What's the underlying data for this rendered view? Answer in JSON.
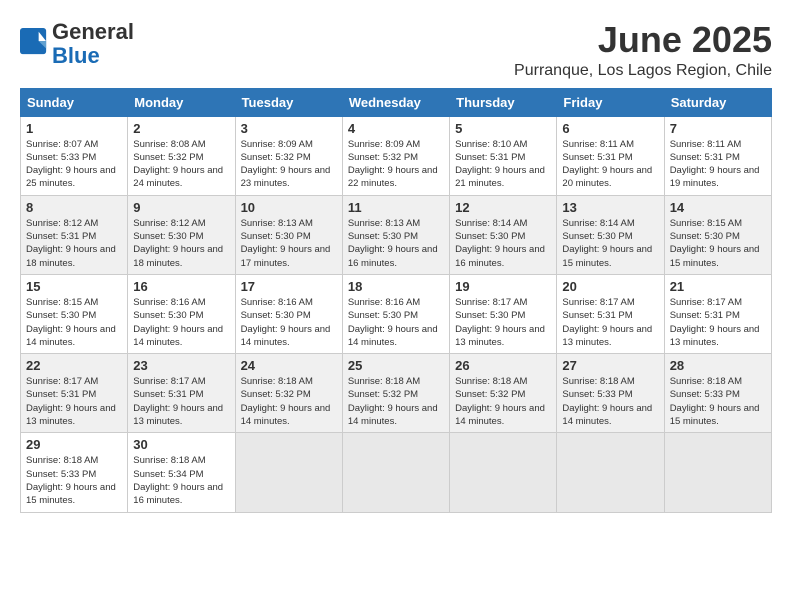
{
  "logo": {
    "general": "General",
    "blue": "Blue"
  },
  "title": "June 2025",
  "location": "Purranque, Los Lagos Region, Chile",
  "weekdays": [
    "Sunday",
    "Monday",
    "Tuesday",
    "Wednesday",
    "Thursday",
    "Friday",
    "Saturday"
  ],
  "weeks": [
    [
      {
        "day": "1",
        "sunrise": "8:07 AM",
        "sunset": "5:33 PM",
        "daylight": "9 hours and 25 minutes."
      },
      {
        "day": "2",
        "sunrise": "8:08 AM",
        "sunset": "5:32 PM",
        "daylight": "9 hours and 24 minutes."
      },
      {
        "day": "3",
        "sunrise": "8:09 AM",
        "sunset": "5:32 PM",
        "daylight": "9 hours and 23 minutes."
      },
      {
        "day": "4",
        "sunrise": "8:09 AM",
        "sunset": "5:32 PM",
        "daylight": "9 hours and 22 minutes."
      },
      {
        "day": "5",
        "sunrise": "8:10 AM",
        "sunset": "5:31 PM",
        "daylight": "9 hours and 21 minutes."
      },
      {
        "day": "6",
        "sunrise": "8:11 AM",
        "sunset": "5:31 PM",
        "daylight": "9 hours and 20 minutes."
      },
      {
        "day": "7",
        "sunrise": "8:11 AM",
        "sunset": "5:31 PM",
        "daylight": "9 hours and 19 minutes."
      }
    ],
    [
      {
        "day": "8",
        "sunrise": "8:12 AM",
        "sunset": "5:31 PM",
        "daylight": "9 hours and 18 minutes."
      },
      {
        "day": "9",
        "sunrise": "8:12 AM",
        "sunset": "5:30 PM",
        "daylight": "9 hours and 18 minutes."
      },
      {
        "day": "10",
        "sunrise": "8:13 AM",
        "sunset": "5:30 PM",
        "daylight": "9 hours and 17 minutes."
      },
      {
        "day": "11",
        "sunrise": "8:13 AM",
        "sunset": "5:30 PM",
        "daylight": "9 hours and 16 minutes."
      },
      {
        "day": "12",
        "sunrise": "8:14 AM",
        "sunset": "5:30 PM",
        "daylight": "9 hours and 16 minutes."
      },
      {
        "day": "13",
        "sunrise": "8:14 AM",
        "sunset": "5:30 PM",
        "daylight": "9 hours and 15 minutes."
      },
      {
        "day": "14",
        "sunrise": "8:15 AM",
        "sunset": "5:30 PM",
        "daylight": "9 hours and 15 minutes."
      }
    ],
    [
      {
        "day": "15",
        "sunrise": "8:15 AM",
        "sunset": "5:30 PM",
        "daylight": "9 hours and 14 minutes."
      },
      {
        "day": "16",
        "sunrise": "8:16 AM",
        "sunset": "5:30 PM",
        "daylight": "9 hours and 14 minutes."
      },
      {
        "day": "17",
        "sunrise": "8:16 AM",
        "sunset": "5:30 PM",
        "daylight": "9 hours and 14 minutes."
      },
      {
        "day": "18",
        "sunrise": "8:16 AM",
        "sunset": "5:30 PM",
        "daylight": "9 hours and 14 minutes."
      },
      {
        "day": "19",
        "sunrise": "8:17 AM",
        "sunset": "5:30 PM",
        "daylight": "9 hours and 13 minutes."
      },
      {
        "day": "20",
        "sunrise": "8:17 AM",
        "sunset": "5:31 PM",
        "daylight": "9 hours and 13 minutes."
      },
      {
        "day": "21",
        "sunrise": "8:17 AM",
        "sunset": "5:31 PM",
        "daylight": "9 hours and 13 minutes."
      }
    ],
    [
      {
        "day": "22",
        "sunrise": "8:17 AM",
        "sunset": "5:31 PM",
        "daylight": "9 hours and 13 minutes."
      },
      {
        "day": "23",
        "sunrise": "8:17 AM",
        "sunset": "5:31 PM",
        "daylight": "9 hours and 13 minutes."
      },
      {
        "day": "24",
        "sunrise": "8:18 AM",
        "sunset": "5:32 PM",
        "daylight": "9 hours and 14 minutes."
      },
      {
        "day": "25",
        "sunrise": "8:18 AM",
        "sunset": "5:32 PM",
        "daylight": "9 hours and 14 minutes."
      },
      {
        "day": "26",
        "sunrise": "8:18 AM",
        "sunset": "5:32 PM",
        "daylight": "9 hours and 14 minutes."
      },
      {
        "day": "27",
        "sunrise": "8:18 AM",
        "sunset": "5:33 PM",
        "daylight": "9 hours and 14 minutes."
      },
      {
        "day": "28",
        "sunrise": "8:18 AM",
        "sunset": "5:33 PM",
        "daylight": "9 hours and 15 minutes."
      }
    ],
    [
      {
        "day": "29",
        "sunrise": "8:18 AM",
        "sunset": "5:33 PM",
        "daylight": "9 hours and 15 minutes."
      },
      {
        "day": "30",
        "sunrise": "8:18 AM",
        "sunset": "5:34 PM",
        "daylight": "9 hours and 16 minutes."
      },
      null,
      null,
      null,
      null,
      null
    ]
  ]
}
